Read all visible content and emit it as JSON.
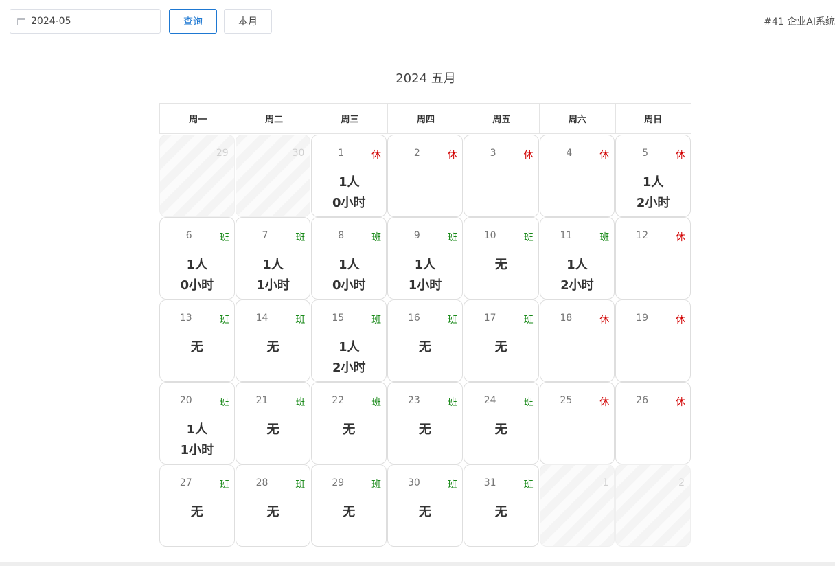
{
  "toolbar": {
    "month_value": "2024-05",
    "query_label": "查询",
    "this_month_label": "本月",
    "system_tag": "#41 企业AI系统"
  },
  "calendar": {
    "title": "2024 五月",
    "weekdays": [
      "周一",
      "周二",
      "周三",
      "周四",
      "周五",
      "周六",
      "周日"
    ],
    "rest_label": "休",
    "work_label": "班",
    "days": [
      {
        "day": "29",
        "out": true,
        "tag": "",
        "people": "",
        "hours": ""
      },
      {
        "day": "30",
        "out": true,
        "tag": "",
        "people": "",
        "hours": ""
      },
      {
        "day": "1",
        "out": false,
        "tag": "休",
        "people": "1人",
        "hours": "0小时"
      },
      {
        "day": "2",
        "out": false,
        "tag": "休",
        "people": "",
        "hours": ""
      },
      {
        "day": "3",
        "out": false,
        "tag": "休",
        "people": "",
        "hours": ""
      },
      {
        "day": "4",
        "out": false,
        "tag": "休",
        "people": "",
        "hours": ""
      },
      {
        "day": "5",
        "out": false,
        "tag": "休",
        "people": "1人",
        "hours": "2小时"
      },
      {
        "day": "6",
        "out": false,
        "tag": "班",
        "people": "1人",
        "hours": "0小时"
      },
      {
        "day": "7",
        "out": false,
        "tag": "班",
        "people": "1人",
        "hours": "1小时"
      },
      {
        "day": "8",
        "out": false,
        "tag": "班",
        "people": "1人",
        "hours": "0小时"
      },
      {
        "day": "9",
        "out": false,
        "tag": "班",
        "people": "1人",
        "hours": "1小时"
      },
      {
        "day": "10",
        "out": false,
        "tag": "班",
        "people": "无",
        "hours": ""
      },
      {
        "day": "11",
        "out": false,
        "tag": "班",
        "people": "1人",
        "hours": "2小时"
      },
      {
        "day": "12",
        "out": false,
        "tag": "休",
        "people": "",
        "hours": ""
      },
      {
        "day": "13",
        "out": false,
        "tag": "班",
        "people": "无",
        "hours": ""
      },
      {
        "day": "14",
        "out": false,
        "tag": "班",
        "people": "无",
        "hours": ""
      },
      {
        "day": "15",
        "out": false,
        "tag": "班",
        "people": "1人",
        "hours": "2小时"
      },
      {
        "day": "16",
        "out": false,
        "tag": "班",
        "people": "无",
        "hours": ""
      },
      {
        "day": "17",
        "out": false,
        "tag": "班",
        "people": "无",
        "hours": ""
      },
      {
        "day": "18",
        "out": false,
        "tag": "休",
        "people": "",
        "hours": ""
      },
      {
        "day": "19",
        "out": false,
        "tag": "休",
        "people": "",
        "hours": ""
      },
      {
        "day": "20",
        "out": false,
        "tag": "班",
        "people": "1人",
        "hours": "1小时"
      },
      {
        "day": "21",
        "out": false,
        "tag": "班",
        "people": "无",
        "hours": ""
      },
      {
        "day": "22",
        "out": false,
        "tag": "班",
        "people": "无",
        "hours": ""
      },
      {
        "day": "23",
        "out": false,
        "tag": "班",
        "people": "无",
        "hours": ""
      },
      {
        "day": "24",
        "out": false,
        "tag": "班",
        "people": "无",
        "hours": ""
      },
      {
        "day": "25",
        "out": false,
        "tag": "休",
        "people": "",
        "hours": ""
      },
      {
        "day": "26",
        "out": false,
        "tag": "休",
        "people": "",
        "hours": ""
      },
      {
        "day": "27",
        "out": false,
        "tag": "班",
        "people": "无",
        "hours": ""
      },
      {
        "day": "28",
        "out": false,
        "tag": "班",
        "people": "无",
        "hours": ""
      },
      {
        "day": "29",
        "out": false,
        "tag": "班",
        "people": "无",
        "hours": ""
      },
      {
        "day": "30",
        "out": false,
        "tag": "班",
        "people": "无",
        "hours": ""
      },
      {
        "day": "31",
        "out": false,
        "tag": "班",
        "people": "无",
        "hours": ""
      },
      {
        "day": "1",
        "out": true,
        "tag": "",
        "people": "",
        "hours": ""
      },
      {
        "day": "2",
        "out": true,
        "tag": "",
        "people": "",
        "hours": ""
      }
    ]
  },
  "colors": {
    "accent": "#1e78d2",
    "rest": "#d20000",
    "work": "#1a8a1a"
  }
}
